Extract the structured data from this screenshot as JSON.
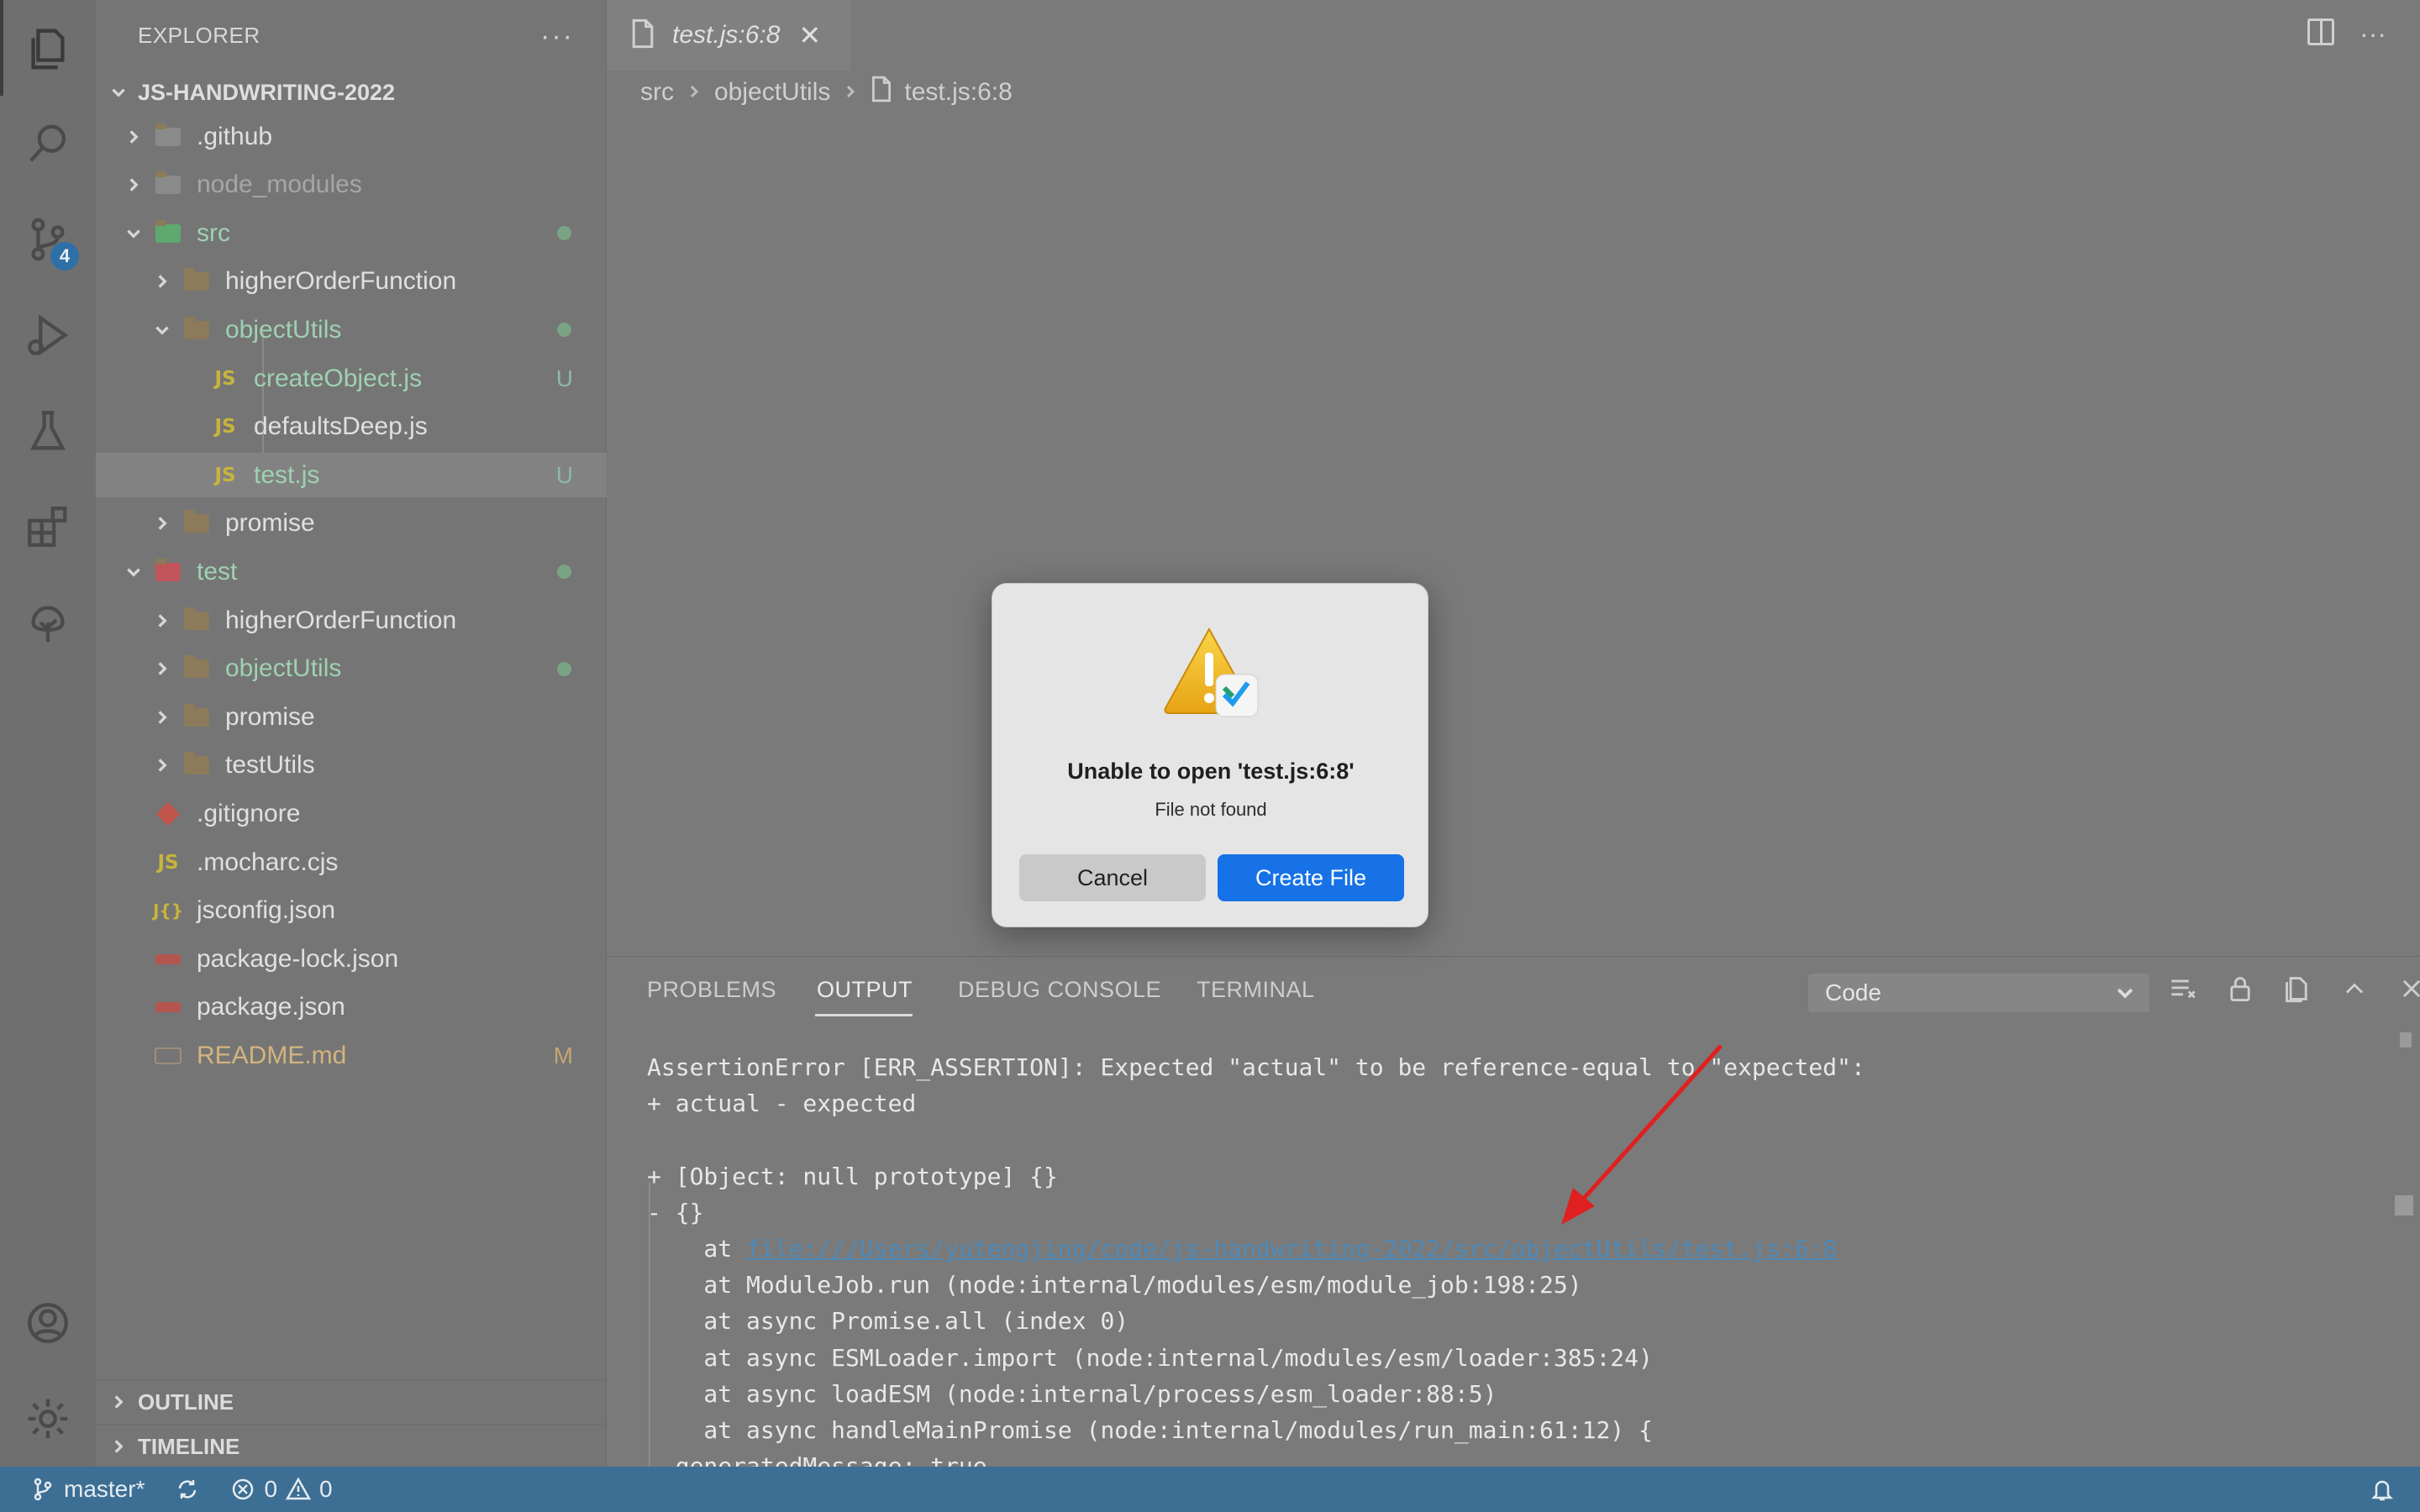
{
  "sidebar": {
    "header": "EXPLORER",
    "more": "···",
    "root": "JS-HANDWRITING-2022",
    "tree": [
      {
        "label": ".github",
        "kind": "folder-special",
        "expanded": false,
        "indent": 0
      },
      {
        "label": "node_modules",
        "kind": "folder-special",
        "expanded": false,
        "indent": 0
      },
      {
        "label": "src",
        "kind": "folder-special",
        "expanded": true,
        "indent": 0
      },
      {
        "label": "higherOrderFunction",
        "kind": "folder",
        "expanded": false,
        "indent": 1
      },
      {
        "label": "objectUtils",
        "kind": "folder",
        "expanded": true,
        "indent": 1
      },
      {
        "label": "createObject.js",
        "kind": "js",
        "indent": 2,
        "status": "U"
      },
      {
        "label": "defaultsDeep.js",
        "kind": "js",
        "indent": 2
      },
      {
        "label": "test.js",
        "kind": "js",
        "indent": 2,
        "status": "U"
      },
      {
        "label": "promise",
        "kind": "folder",
        "expanded": false,
        "indent": 1
      },
      {
        "label": "test",
        "kind": "folder-special",
        "expanded": true,
        "indent": 0
      },
      {
        "label": "higherOrderFunction",
        "kind": "folder",
        "expanded": false,
        "indent": 1
      },
      {
        "label": "objectUtils",
        "kind": "folder",
        "expanded": false,
        "indent": 1
      },
      {
        "label": "promise",
        "kind": "folder",
        "expanded": false,
        "indent": 1
      },
      {
        "label": "testUtils",
        "kind": "folder",
        "expanded": false,
        "indent": 1
      },
      {
        "label": ".gitignore",
        "kind": "git",
        "indent": 0
      },
      {
        "label": ".mocharc.cjs",
        "kind": "js",
        "indent": 0
      },
      {
        "label": "jsconfig.json",
        "kind": "jsconfig",
        "indent": 0
      },
      {
        "label": "package-lock.json",
        "kind": "npm",
        "indent": 0
      },
      {
        "label": "package.json",
        "kind": "npm",
        "indent": 0
      },
      {
        "label": "README.md",
        "kind": "md",
        "indent": 0,
        "status": "M"
      }
    ],
    "outline": "OUTLINE",
    "timeline": "TIMELINE"
  },
  "activity_badge": "4",
  "editor": {
    "tab_label": "test.js:6:8",
    "tab_close": "✕",
    "breadcrumb": [
      "src",
      "objectUtils",
      "test.js:6:8"
    ],
    "more": "···"
  },
  "panel": {
    "tabs": [
      "PROBLEMS",
      "OUTPUT",
      "DEBUG CONSOLE",
      "TERMINAL"
    ],
    "active_tab": "OUTPUT",
    "channel": "Code",
    "output_lines": [
      "AssertionError [ERR_ASSERTION]: Expected \"actual\" to be reference-equal to \"expected\":",
      "+ actual - expected",
      "",
      "+ [Object: null prototype] {}",
      "- {}",
      "    at ",
      "    at ModuleJob.run (node:internal/modules/esm/module_job:198:25)",
      "    at async Promise.all (index 0)",
      "    at async ESMLoader.import (node:internal/modules/esm/loader:385:24)",
      "    at async loadESM (node:internal/process/esm_loader:88:5)",
      "    at async handleMainPromise (node:internal/modules/run_main:61:12) {",
      "  generatedMessage: true,"
    ],
    "link_text": "file:///Users/yutengjing/code/js-handwriting-2022/src/objectUtils/test.js:6:8"
  },
  "dialog": {
    "title": "Unable to open 'test.js:6:8'",
    "message": "File not found",
    "cancel": "Cancel",
    "create": "Create File"
  },
  "statusbar": {
    "branch": "master*",
    "errors": "0",
    "warnings": "0"
  },
  "colors": {
    "accent_blue": "#1672e6",
    "statusbar": "#3d6e93",
    "git_untracked": "#9fd1b2",
    "git_modified": "#d3b47e",
    "annotation_arrow": "#e02020"
  }
}
